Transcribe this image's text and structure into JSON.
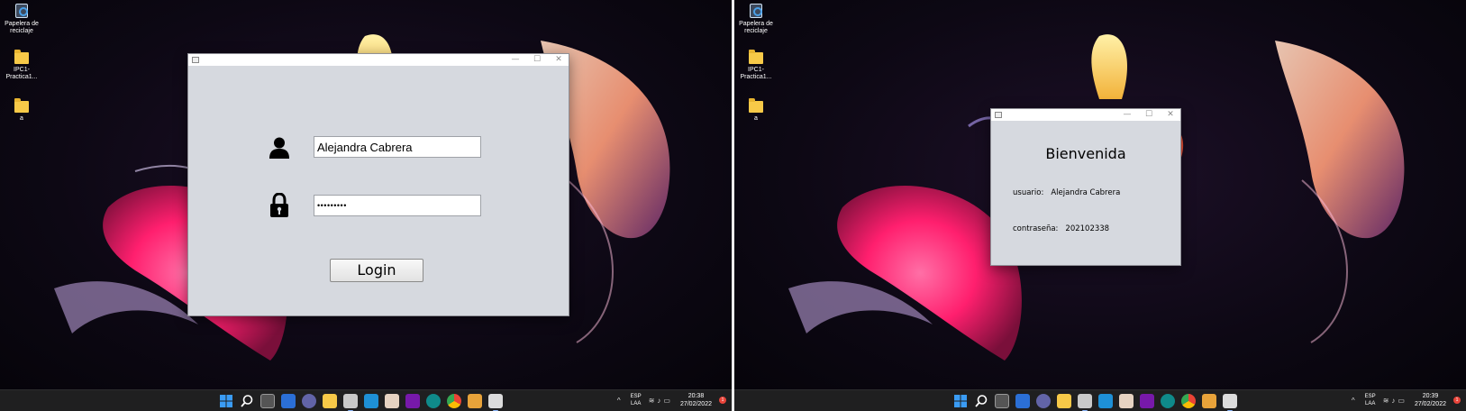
{
  "desktop": {
    "icons": [
      {
        "label": "Papelera de reciclaje",
        "icon": "recycle-bin-icon"
      },
      {
        "label": "IPC1-Practica1...",
        "icon": "folder-icon"
      },
      {
        "label": "a",
        "icon": "folder-icon"
      }
    ]
  },
  "taskbar": {
    "language_top": "ESP",
    "language_bottom": "LAA",
    "left_clock": {
      "time": "20:38",
      "date": "27/02/2022"
    },
    "right_clock": {
      "time": "20:39",
      "date": "27/02/2022"
    },
    "notification_badge": "1",
    "pinned": [
      "windows-start-icon",
      "search-icon",
      "task-view-icon",
      "widgets-icon",
      "teams-chat-icon",
      "file-explorer-icon",
      "java-app-icon",
      "l-app-icon",
      "photos-icon",
      "onenote-icon",
      "app-icon",
      "chrome-icon",
      "app-icon",
      "java-icon"
    ]
  },
  "login_window": {
    "username_value": "Alejandra Cabrera",
    "password_value": "•••••••••",
    "login_label": "Login",
    "controls": {
      "minimize": "—",
      "maximize": "☐",
      "close": "✕"
    }
  },
  "welcome_window": {
    "title": "Bienvenida",
    "user_label": "usuario:",
    "user_value": "Alejandra Cabrera",
    "password_label": "contraseña:",
    "password_value": "202102338",
    "controls": {
      "minimize": "—",
      "maximize": "☐",
      "close": "✕"
    }
  },
  "colors": {
    "window_bg": "#d6d9df",
    "taskbar_bg": "#1f1f20",
    "folder": "#f7c948",
    "accent_pink": "#ff2a78"
  }
}
